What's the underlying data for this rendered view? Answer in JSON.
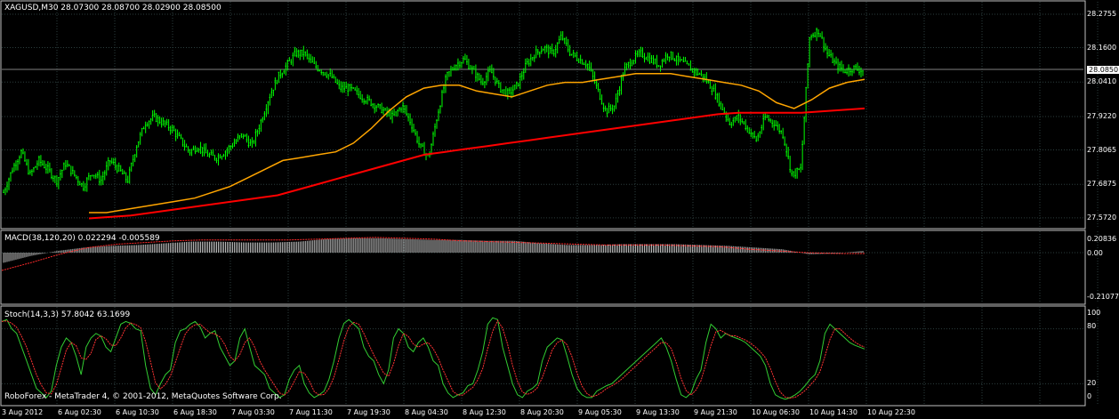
{
  "app": {
    "footer": "RoboForex - MetaTrader 4, © 2001-2012, MetaQuotes Software Corp."
  },
  "colors": {
    "background": "#000000",
    "grid": "#2c3e3e",
    "candles": "#00ff00",
    "ma_fast": "#ffa500",
    "ma_slow": "#ff0000",
    "macd_hist": "#c0c0c0",
    "macd_signal": "#ff2a2a",
    "stoch_main": "#32cd32",
    "stoch_signal": "#ff3333",
    "text": "#ffffff"
  },
  "main_panel": {
    "label": "XAGUSD,M30  28.07300 28.08700 28.02900 28.08500",
    "current_price": "28.0850",
    "price_axis": [
      "28.2755",
      "28.1600",
      "28.0410",
      "27.9220",
      "27.8065",
      "27.6875",
      "27.5720"
    ],
    "close_path": [
      27.66,
      27.74,
      27.8,
      27.72,
      27.77,
      27.74,
      27.7,
      27.76,
      27.72,
      27.68,
      27.73,
      27.7,
      27.77,
      27.74,
      27.7,
      27.82,
      27.9,
      27.92,
      27.9,
      27.88,
      27.84,
      27.8,
      27.82,
      27.79,
      27.78,
      27.8,
      27.83,
      27.86,
      27.82,
      27.9,
      27.99,
      28.06,
      28.1,
      28.14,
      28.14,
      28.1,
      28.08,
      28.06,
      28.02,
      28.02,
      28.0,
      27.98,
      27.96,
      27.94,
      27.92,
      27.96,
      27.9,
      27.82,
      27.78,
      27.93,
      28.06,
      28.1,
      28.12,
      28.08,
      28.04,
      28.08,
      28.02,
      28.0,
      28.03,
      28.1,
      28.14,
      28.16,
      28.14,
      28.2,
      28.14,
      28.12,
      28.1,
      28.02,
      27.94,
      27.96,
      28.08,
      28.12,
      28.14,
      28.12,
      28.1,
      28.14,
      28.12,
      28.1,
      28.08,
      28.06,
      28.02,
      27.96,
      27.9,
      27.92,
      27.88,
      27.84,
      27.92,
      27.9,
      27.86,
      27.72,
      27.74,
      28.2,
      28.22,
      28.14,
      28.1,
      28.08,
      28.09,
      28.08
    ],
    "ma_fast_path": [
      27.59,
      27.59,
      27.6,
      27.61,
      27.62,
      27.63,
      27.64,
      27.66,
      27.68,
      27.71,
      27.74,
      27.77,
      27.78,
      27.79,
      27.8,
      27.83,
      27.88,
      27.94,
      27.99,
      28.02,
      28.03,
      28.03,
      28.01,
      28.0,
      27.99,
      28.01,
      28.03,
      28.04,
      28.04,
      28.05,
      28.06,
      28.07,
      28.07,
      28.07,
      28.06,
      28.05,
      28.04,
      28.03,
      28.01,
      27.97,
      27.95,
      27.98,
      28.02,
      28.04,
      28.05
    ],
    "ma_slow_path": [
      27.57,
      27.575,
      27.58,
      27.59,
      27.6,
      27.61,
      27.62,
      27.63,
      27.64,
      27.65,
      27.67,
      27.69,
      27.71,
      27.73,
      27.75,
      27.77,
      27.79,
      27.8,
      27.81,
      27.82,
      27.83,
      27.84,
      27.85,
      27.86,
      27.87,
      27.88,
      27.89,
      27.9,
      27.91,
      27.92,
      27.93,
      27.935,
      27.935,
      27.935,
      27.935,
      27.94,
      27.945,
      27.95
    ]
  },
  "macd_panel": {
    "label": "MACD(38,120,20) 0.022294 -0.005589",
    "axis": [
      "0.20836",
      "0.00",
      "-0.21077"
    ],
    "hist_path": [
      -0.12,
      -0.04,
      0.02,
      0.06,
      0.08,
      0.09,
      0.11,
      0.13,
      0.13,
      0.12,
      0.12,
      0.13,
      0.16,
      0.17,
      0.17,
      0.16,
      0.15,
      0.15,
      0.14,
      0.14,
      0.11,
      0.09,
      0.09,
      0.1,
      0.1,
      0.1,
      0.09,
      0.08,
      0.06,
      0.04,
      -0.02,
      -0.01,
      0.02
    ],
    "signal_path": [
      -0.21,
      -0.12,
      -0.02,
      0.06,
      0.1,
      0.12,
      0.14,
      0.15,
      0.15,
      0.15,
      0.15,
      0.16,
      0.17,
      0.18,
      0.17,
      0.16,
      0.14,
      0.13,
      0.12,
      0.11,
      0.1,
      0.09,
      0.09,
      0.09,
      0.08,
      0.07,
      0.04,
      0.02,
      0.0,
      -0.01,
      -0.01
    ]
  },
  "stoch_panel": {
    "label": "Stoch(14,3,3) 57.8042 63.1699",
    "axis": [
      "100",
      "80",
      "20",
      "0"
    ],
    "main_path": [
      88,
      90,
      80,
      75,
      60,
      45,
      30,
      15,
      10,
      5,
      12,
      40,
      60,
      70,
      65,
      50,
      30,
      60,
      70,
      75,
      72,
      60,
      55,
      70,
      85,
      88,
      86,
      80,
      78,
      40,
      15,
      8,
      20,
      30,
      35,
      65,
      78,
      80,
      85,
      88,
      82,
      70,
      75,
      78,
      60,
      50,
      40,
      45,
      70,
      80,
      60,
      40,
      35,
      30,
      15,
      10,
      5,
      8,
      25,
      35,
      40,
      20,
      10,
      5,
      8,
      12,
      25,
      45,
      70,
      86,
      90,
      85,
      80,
      60,
      50,
      45,
      30,
      20,
      35,
      70,
      80,
      75,
      60,
      55,
      65,
      70,
      60,
      45,
      40,
      20,
      10,
      5,
      8,
      10,
      18,
      20,
      35,
      55,
      85,
      92,
      90,
      60,
      40,
      20,
      8,
      5,
      12,
      15,
      20,
      45,
      60,
      65,
      70,
      68,
      50,
      30,
      15,
      8,
      5,
      5,
      12,
      15,
      18,
      20,
      25,
      30,
      35,
      40,
      45,
      50,
      55,
      60,
      65,
      70,
      60,
      45,
      25,
      8,
      5,
      10,
      25,
      35,
      65,
      85,
      80,
      70,
      75,
      72,
      70,
      68,
      65,
      60,
      55,
      50,
      40,
      20,
      8,
      5,
      3,
      5,
      8,
      12,
      18,
      25,
      30,
      45,
      75,
      85,
      80,
      75,
      70,
      65,
      62,
      60,
      58
    ]
  },
  "time_axis": [
    "3 Aug 2012",
    "6 Aug 02:30",
    "6 Aug 10:30",
    "6 Aug 18:30",
    "7 Aug 03:30",
    "7 Aug 11:30",
    "7 Aug 19:30",
    "8 Aug 04:30",
    "8 Aug 12:30",
    "8 Aug 20:30",
    "9 Aug 05:30",
    "9 Aug 13:30",
    "9 Aug 21:30",
    "10 Aug 06:30",
    "10 Aug 14:30",
    "10 Aug 22:30"
  ]
}
